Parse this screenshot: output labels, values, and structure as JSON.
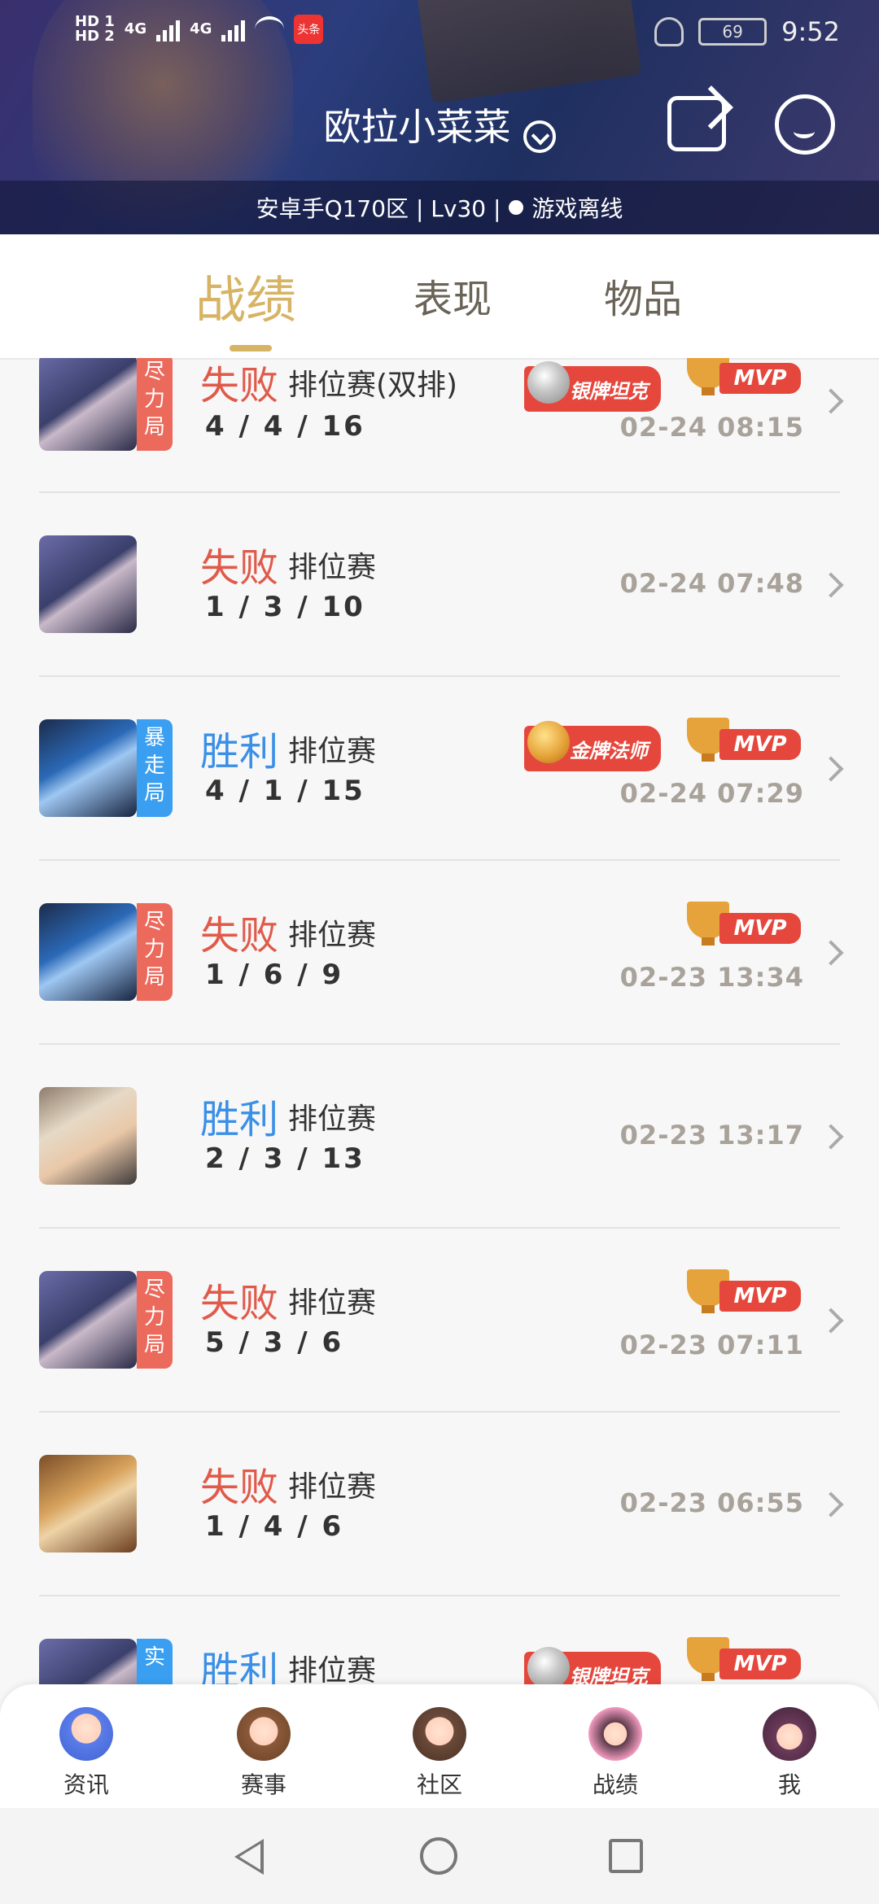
{
  "status_bar": {
    "sim1": "HD 1",
    "sim2": "HD 2",
    "net1": "4G",
    "net2": "4G",
    "app_badge": "头条",
    "battery": "69",
    "time": "9:52"
  },
  "profile": {
    "name": "欧拉小菜菜",
    "info": "安卓手Q170区 | Lv30 |",
    "status": "游戏离线"
  },
  "tabs": [
    "战绩",
    "表现",
    "物品"
  ],
  "matches": [
    {
      "tag": "尽力局",
      "result": "失败",
      "mode": "排位赛(双排)",
      "kda": "4 / 4 / 16",
      "date": "02-24 08:15",
      "medal": "银牌坦克",
      "mvp": "MVP"
    },
    {
      "tag": "",
      "result": "失败",
      "mode": "排位赛",
      "kda": "1 / 3 / 10",
      "date": "02-24 07:48",
      "medal": "",
      "mvp": ""
    },
    {
      "tag": "暴走局",
      "result": "胜利",
      "mode": "排位赛",
      "kda": "4 / 1 / 15",
      "date": "02-24 07:29",
      "medal": "金牌法师",
      "mvp": "MVP"
    },
    {
      "tag": "尽力局",
      "result": "失败",
      "mode": "排位赛",
      "kda": "1 / 6 / 9",
      "date": "02-23 13:34",
      "medal": "",
      "mvp": "MVP"
    },
    {
      "tag": "",
      "result": "胜利",
      "mode": "排位赛",
      "kda": "2 / 3 / 13",
      "date": "02-23 13:17",
      "medal": "",
      "mvp": ""
    },
    {
      "tag": "尽力局",
      "result": "失败",
      "mode": "排位赛",
      "kda": "5 / 3 / 6",
      "date": "02-23 07:11",
      "medal": "",
      "mvp": "MVP"
    },
    {
      "tag": "",
      "result": "失败",
      "mode": "排位赛",
      "kda": "1 / 4 / 6",
      "date": "02-23 06:55",
      "medal": "",
      "mvp": ""
    },
    {
      "tag": "实",
      "result": "胜利",
      "mode": "排位赛",
      "kda": "",
      "date": "",
      "medal": "银牌坦克",
      "mvp": "MVP"
    }
  ],
  "bottom_nav": [
    "资讯",
    "赛事",
    "社区",
    "战绩",
    "我"
  ],
  "colors": {
    "accent": "#d7b364",
    "lose": "#e05a4a",
    "win": "#3a8fe6",
    "tag_red": "#ec6a5c",
    "tag_blue": "#3a9ff0"
  }
}
